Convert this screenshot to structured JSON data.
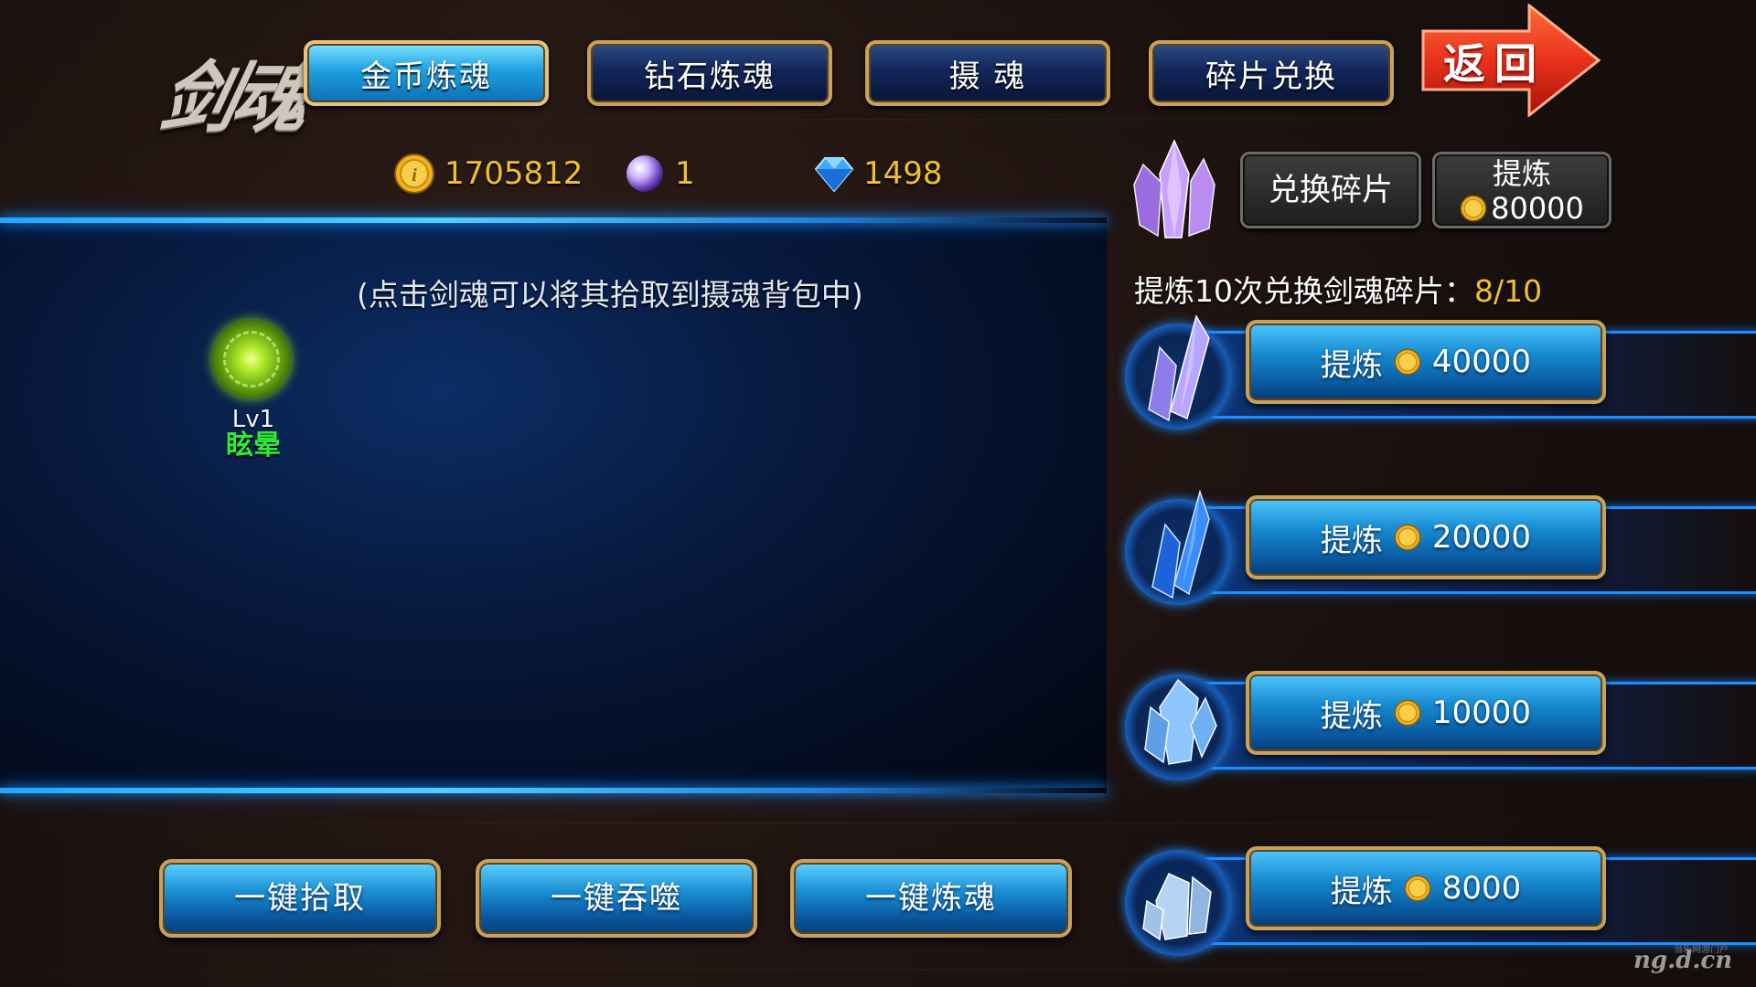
{
  "title": "剑魂",
  "tabs": [
    {
      "label": "金币炼魂",
      "active": true
    },
    {
      "label": "钻石炼魂",
      "active": false
    },
    {
      "label": "摄 魂",
      "active": false
    },
    {
      "label": "碎片兑换",
      "active": false
    }
  ],
  "return_label": "返回",
  "currencies": {
    "gold": "1705812",
    "orb": "1",
    "diamond": "1498"
  },
  "hint": "(点击剑魂可以将其拾取到摄魂背包中)",
  "soul_item": {
    "level": "Lv1",
    "name": "眩晕",
    "name_color": "#2ee83a"
  },
  "bottom_buttons": [
    "一键拾取",
    "一键吞噬",
    "一键炼魂"
  ],
  "exchange": {
    "exchange_label": "兑换碎片",
    "refine_label": "提炼",
    "refine_cost": "80000"
  },
  "progress": {
    "label": "提炼10次兑换剑魂碎片：",
    "value": "8/10"
  },
  "refine_options": [
    {
      "label": "提炼",
      "cost": "40000",
      "crystal_color": "purple"
    },
    {
      "label": "提炼",
      "cost": "20000",
      "crystal_color": "blue"
    },
    {
      "label": "提炼",
      "cost": "10000",
      "crystal_color": "light-blue"
    },
    {
      "label": "提炼",
      "cost": "8000",
      "crystal_color": "pale-blue"
    }
  ],
  "watermark": "ng.d.cn",
  "watermark_small": "当乐网游门户",
  "colors": {
    "gold_text": "#f1c02c",
    "tab_active": "#1fa0e0",
    "tab_inactive": "#12265a",
    "button_border": "#c9a25a",
    "return_arrow": "#e8321c"
  }
}
